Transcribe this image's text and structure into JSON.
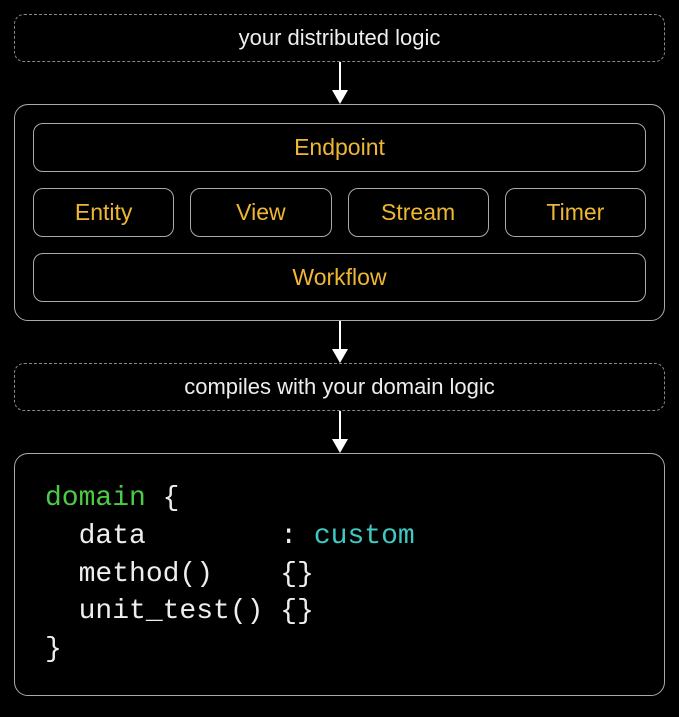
{
  "top": {
    "label": "your distributed logic"
  },
  "components": {
    "endpoint": "Endpoint",
    "entity": "Entity",
    "view": "View",
    "stream": "Stream",
    "timer": "Timer",
    "workflow": "Workflow"
  },
  "compiles": {
    "label": "compiles with your domain logic"
  },
  "code": {
    "keyword": "domain",
    "brace_open": " {",
    "line_data_left": "  data        ",
    "line_data_colon": ": ",
    "line_data_type": "custom",
    "line_method": "  method()    {}",
    "line_unit": "  unit_test() {}",
    "brace_close": "}"
  }
}
